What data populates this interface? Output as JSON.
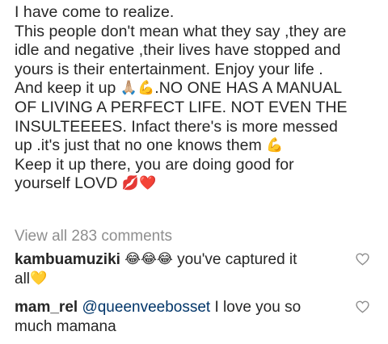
{
  "caption": {
    "lines": [
      {
        "text": "I have come to realize.",
        "emoji": ""
      },
      {
        "text": "This people don't mean what they say ,they are",
        "emoji": ""
      },
      {
        "text": "idle and negative ,their lives have stopped and",
        "emoji": ""
      },
      {
        "text": "yours is their entertainment. Enjoy your life .",
        "emoji": ""
      },
      {
        "text": "And keep it up ",
        "emoji": "🙏🏼💪",
        "after": ".NO ONE HAS A MANUAL"
      },
      {
        "text": "OF LIVING A PERFECT LIFE. NOT EVEN THE",
        "emoji": ""
      },
      {
        "text": "INSULTEEEES. Infact there's is more messed",
        "emoji": ""
      },
      {
        "text": "up .it's just that no one knows them ",
        "emoji": "💪"
      },
      {
        "text": "Keep it up there, you are doing good for",
        "emoji": ""
      },
      {
        "text": "yourself LOVD ",
        "emoji": "💋❤️"
      }
    ]
  },
  "view_all_comments": "View all 283 comments",
  "comments": [
    {
      "username": "kambuamuziki",
      "emoji": "😂😂😂",
      "text": " you've captured it",
      "continuation": "all",
      "continuation_emoji": "💛",
      "like_icon": "heart-outline-icon"
    },
    {
      "username": "mam_rel",
      "mention": "@queenveebosset",
      "text": " I love you so",
      "continuation": "much mamana",
      "like_icon": "heart-outline-icon"
    }
  ],
  "colors": {
    "text": "#262626",
    "muted": "#8e8e8e",
    "mention": "#003569",
    "background": "#ffffff"
  }
}
